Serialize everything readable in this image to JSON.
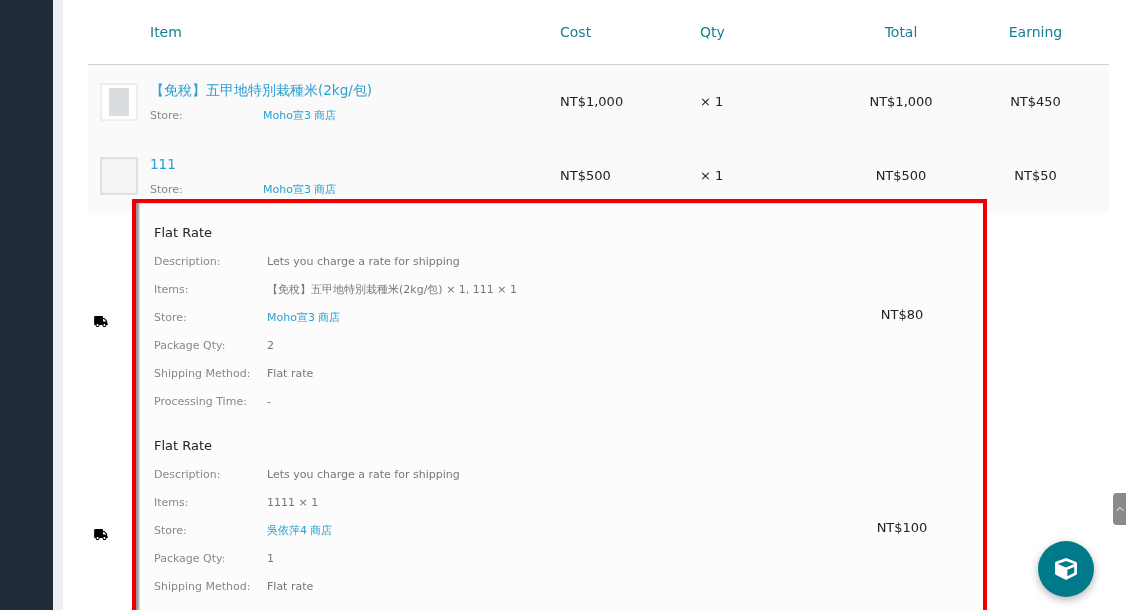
{
  "table": {
    "columns": [
      "Item",
      "Cost",
      "Qty",
      "Total",
      "Earning"
    ],
    "rows": [
      {
        "has_photo": true,
        "name": "【免稅】五甲地特別栽種米(2kg/包)",
        "store_label": "Store:",
        "store": "Moho宣3 商店",
        "cost": "NT$1,000",
        "qty": "× 1",
        "total": "NT$1,000",
        "earning": "NT$450"
      },
      {
        "has_photo": false,
        "name": "111",
        "store_label": "Store:",
        "store": "Moho宣3 商店",
        "cost": "NT$500",
        "qty": "× 1",
        "total": "NT$500",
        "earning": "NT$50"
      }
    ]
  },
  "shipping": [
    {
      "title": "Flat Rate",
      "total": "NT$80",
      "fields": [
        {
          "label": "Description:",
          "value": "Lets you charge a rate for shipping",
          "kind": "text"
        },
        {
          "label": "Items:",
          "value": "【免稅】五甲地特別栽種米(2kg/包) × 1, 111 × 1",
          "kind": "text"
        },
        {
          "label": "Store:",
          "value": "Moho宣3 商店",
          "kind": "link"
        },
        {
          "label": "Package Qty:",
          "value": "2",
          "kind": "text"
        },
        {
          "label": "Shipping Method:",
          "value": "Flat rate",
          "kind": "text"
        },
        {
          "label": "Processing Time:",
          "value": "-",
          "kind": "text"
        }
      ]
    },
    {
      "title": "Flat Rate",
      "total": "NT$100",
      "fields": [
        {
          "label": "Description:",
          "value": "Lets you charge a rate for shipping",
          "kind": "text"
        },
        {
          "label": "Items:",
          "value": "1111 × 1",
          "kind": "text"
        },
        {
          "label": "Store:",
          "value": "吳依萍4 商店",
          "kind": "link"
        },
        {
          "label": "Package Qty:",
          "value": "1",
          "kind": "text"
        },
        {
          "label": "Shipping Method:",
          "value": "Flat rate",
          "kind": "text"
        }
      ]
    }
  ]
}
